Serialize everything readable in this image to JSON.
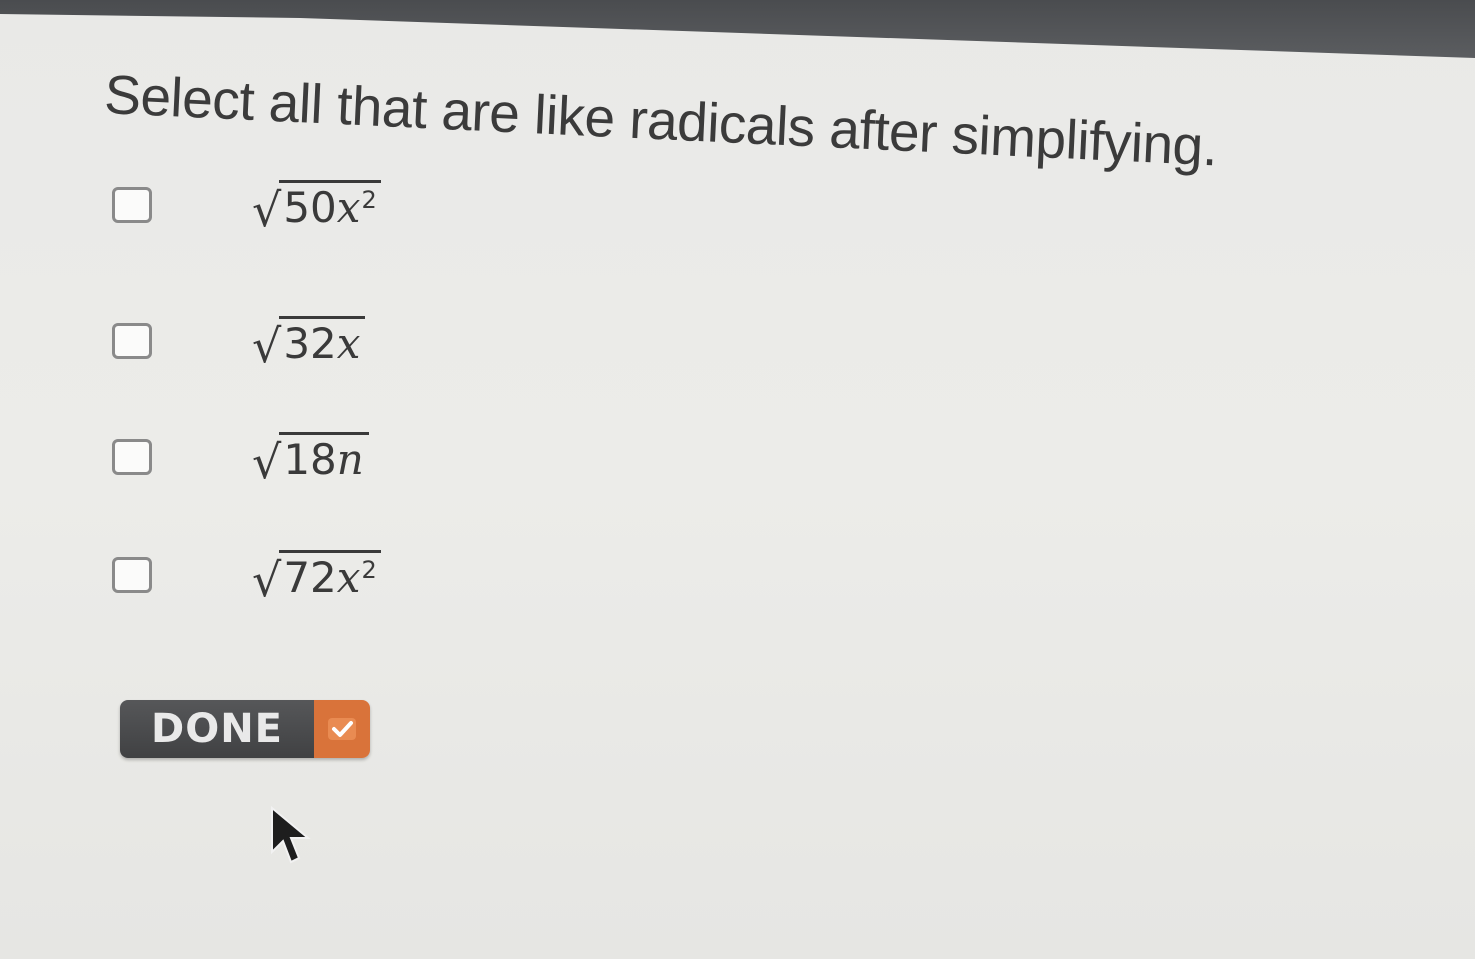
{
  "question": "Select all that are like radicals after simplifying.",
  "options": [
    {
      "coefficient": "50",
      "variable": "x",
      "exponent": "2",
      "checked": false
    },
    {
      "coefficient": "32",
      "variable": "x",
      "exponent": "",
      "checked": false
    },
    {
      "coefficient": "18",
      "variable": "n",
      "exponent": "",
      "checked": false
    },
    {
      "coefficient": "72",
      "variable": "x",
      "exponent": "2",
      "checked": false
    }
  ],
  "done_button": {
    "label": "DONE",
    "icon": "check-icon",
    "accent": "#d9733a"
  },
  "colors": {
    "background": "#ebebe8",
    "text": "#3b3b3b",
    "topbar": "#4f5154"
  }
}
